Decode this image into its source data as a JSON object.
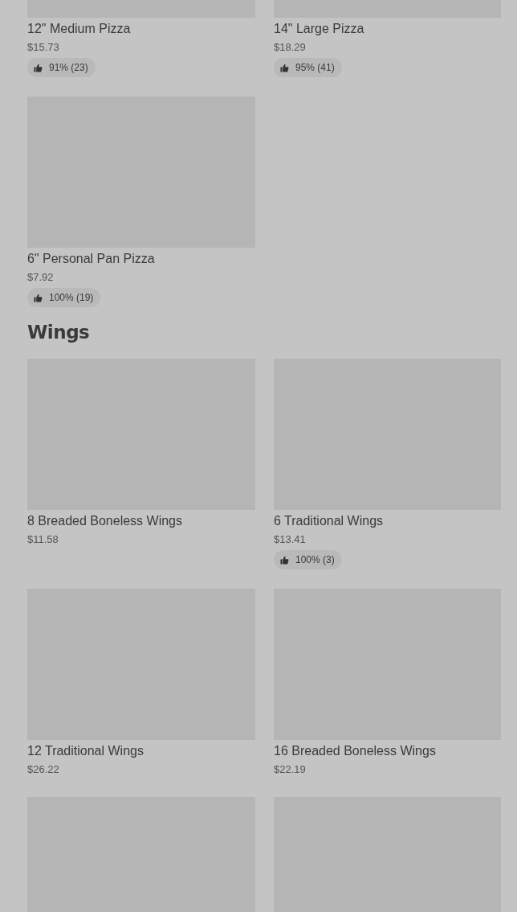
{
  "sections": [
    {
      "items": [
        {
          "kind": "item",
          "name": "12\" Medium Pizza",
          "price": "$15.73",
          "rating": "91% (23)"
        },
        {
          "kind": "item",
          "name": "14\" Large Pizza",
          "price": "$18.29",
          "rating": "95% (41)"
        },
        {
          "kind": "item",
          "name": "6\" Personal Pan Pizza",
          "price": "$7.92",
          "rating": "100% (19)"
        }
      ]
    },
    {
      "heading": "Wings",
      "items": [
        {
          "kind": "item",
          "name": "8 Breaded Boneless Wings",
          "price": "$11.58"
        },
        {
          "kind": "item",
          "name": "6 Traditional Wings",
          "price": "$13.41",
          "rating": "100% (3)"
        },
        {
          "kind": "item",
          "name": "12 Traditional Wings",
          "price": "$26.22"
        },
        {
          "kind": "item",
          "name": "16 Breaded Boneless Wings",
          "price": "$22.19"
        },
        {
          "kind": "image_only"
        },
        {
          "kind": "image_only"
        }
      ]
    }
  ]
}
